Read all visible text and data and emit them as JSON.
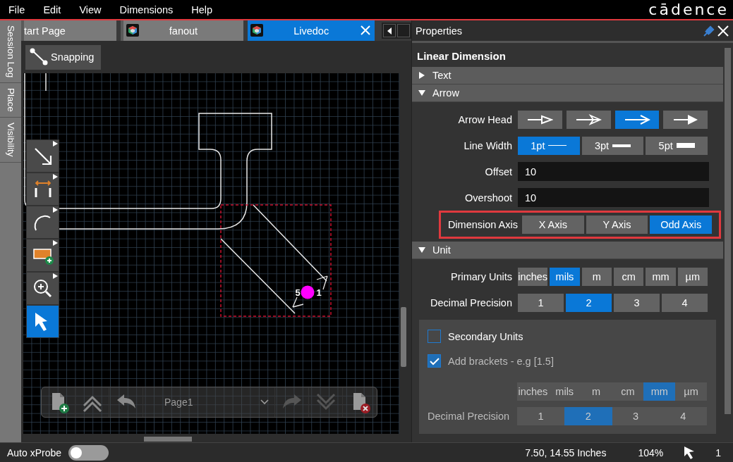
{
  "menu": [
    {
      "label": "File"
    },
    {
      "label": "Edit"
    },
    {
      "label": "View"
    },
    {
      "label": "Dimensions"
    },
    {
      "label": "Help"
    }
  ],
  "logo": "cādence",
  "side_tabs": [
    {
      "label": "Session Log"
    },
    {
      "label": "Place"
    },
    {
      "label": "Visibility"
    }
  ],
  "doc_tabs": [
    {
      "label": "tart Page",
      "has_icon": false,
      "closable": false,
      "selected": false
    },
    {
      "label": "fanout",
      "has_icon": true,
      "closable": false,
      "selected": false
    },
    {
      "label": "Livedoc",
      "has_icon": true,
      "closable": true,
      "selected": true
    }
  ],
  "snapping": "Snapping",
  "tools": [
    {
      "kind": "line",
      "selected": false
    },
    {
      "kind": "dimension",
      "selected": false
    },
    {
      "kind": "arc",
      "selected": false
    },
    {
      "kind": "add-shape",
      "selected": false
    },
    {
      "kind": "zoom",
      "selected": false
    },
    {
      "kind": "select",
      "selected": true
    }
  ],
  "canvas": {
    "dimension_labels": [
      "5",
      "1"
    ]
  },
  "page_bar": {
    "page": "Page1"
  },
  "properties": {
    "title": "Properties",
    "heading": "Linear Dimension",
    "sections": [
      {
        "label": "Text",
        "expanded": false
      },
      {
        "label": "Arrow",
        "expanded": true,
        "rows": [
          {
            "kind": "segmented",
            "label": "Arrow Head",
            "options": [
              {
                "kind": "hollow",
                "selected": false
              },
              {
                "kind": "barbed",
                "selected": false
              },
              {
                "kind": "open",
                "selected": true
              },
              {
                "kind": "filled",
                "selected": false
              }
            ]
          },
          {
            "kind": "segmented",
            "label": "Line Width",
            "options": [
              {
                "label": "1pt",
                "kind": "thin",
                "selected": true
              },
              {
                "label": "3pt",
                "kind": "medium",
                "selected": false
              },
              {
                "label": "5pt",
                "kind": "thick",
                "selected": false
              }
            ]
          },
          {
            "kind": "field",
            "label": "Offset",
            "value": "10"
          },
          {
            "kind": "field",
            "label": "Overshoot",
            "value": "10"
          },
          {
            "kind": "segmented",
            "label": "Dimension Axis",
            "highlighted": true,
            "options": [
              {
                "label": "X Axis",
                "selected": false
              },
              {
                "label": "Y Axis",
                "selected": false
              },
              {
                "label": "Odd Axis",
                "selected": true
              }
            ]
          }
        ]
      },
      {
        "label": "Unit",
        "expanded": true,
        "rows": [
          {
            "kind": "segmented",
            "label": "Primary Units",
            "options": [
              {
                "label": "inches",
                "selected": false
              },
              {
                "label": "mils",
                "selected": true
              },
              {
                "label": "m",
                "selected": false
              },
              {
                "label": "cm",
                "selected": false
              },
              {
                "label": "mm",
                "selected": false
              },
              {
                "label": "µm",
                "selected": false
              }
            ]
          },
          {
            "kind": "segmented",
            "label": "Decimal Precision",
            "options": [
              {
                "label": "1",
                "selected": false
              },
              {
                "label": "2",
                "selected": true
              },
              {
                "label": "3",
                "selected": false
              },
              {
                "label": "4",
                "selected": false
              }
            ]
          }
        ],
        "secondary": {
          "checkboxes": [
            {
              "label": "Secondary Units",
              "checked": false,
              "disabled": false
            },
            {
              "label": "Add brackets - e.g [1.5]",
              "checked": true,
              "disabled": true
            }
          ],
          "rows": [
            {
              "kind": "segmented",
              "disabled": true,
              "options": [
                {
                  "label": "inches",
                  "selected": false
                },
                {
                  "label": "mils",
                  "selected": false
                },
                {
                  "label": "m",
                  "selected": false
                },
                {
                  "label": "cm",
                  "selected": false
                },
                {
                  "label": "mm",
                  "selected": true
                },
                {
                  "label": "µm",
                  "selected": false
                }
              ]
            },
            {
              "kind": "segmented",
              "label": "Decimal Precision",
              "disabled": true,
              "options": [
                {
                  "label": "1",
                  "selected": false
                },
                {
                  "label": "2",
                  "selected": true
                },
                {
                  "label": "3",
                  "selected": false
                },
                {
                  "label": "4",
                  "selected": false
                }
              ]
            }
          ]
        }
      }
    ]
  },
  "status_bar": {
    "auto_xprobe": {
      "label": "Auto xProbe",
      "on": false
    },
    "coordinates": "7.50, 14.55 Inches",
    "zoom": "104%",
    "selection_count": "1"
  }
}
